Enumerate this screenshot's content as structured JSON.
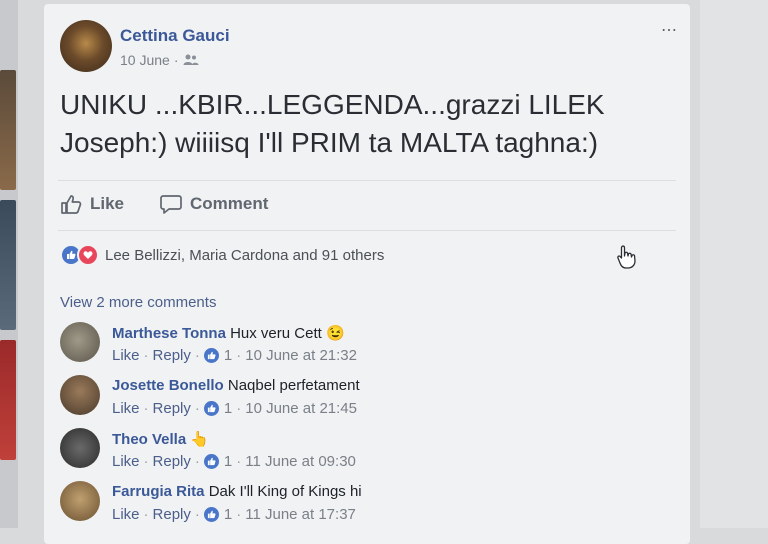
{
  "post": {
    "author": "Cettina Gauci",
    "date": "10 June",
    "audience_icon": "friends-icon",
    "text": "UNIKU ...KBIR...LEGGENDA...grazzi LILEK Joseph:) wiiiisq I'll PRIM ta MALTA taghna:)",
    "more_icon": "⋯"
  },
  "actions": {
    "like_label": "Like",
    "comment_label": "Comment"
  },
  "reactions": {
    "summary": "Lee Bellizzi, Maria Cardona and 91 others"
  },
  "comments": {
    "view_more": "View 2 more comments",
    "items": [
      {
        "author": "Marthese Tonna",
        "text": "Hux veru Cett",
        "emoji": "😉",
        "like": "Like",
        "reply": "Reply",
        "count": "1",
        "time": "10 June at 21:32"
      },
      {
        "author": "Josette Bonello",
        "text": "Naqbel perfetament",
        "emoji": "",
        "like": "Like",
        "reply": "Reply",
        "count": "1",
        "time": "10 June at 21:45"
      },
      {
        "author": "Theo Vella",
        "text": "",
        "emoji": "👆",
        "like": "Like",
        "reply": "Reply",
        "count": "1",
        "time": "11 June at 09:30"
      },
      {
        "author": "Farrugia Rita",
        "text": "Dak I'll King of Kings hi",
        "emoji": "",
        "like": "Like",
        "reply": "Reply",
        "count": "1",
        "time": "11 June at 17:37"
      }
    ]
  },
  "colors": {
    "name_blue": "#3b5998",
    "like_blue": "#4a76c9",
    "love_red": "#e8465b"
  }
}
